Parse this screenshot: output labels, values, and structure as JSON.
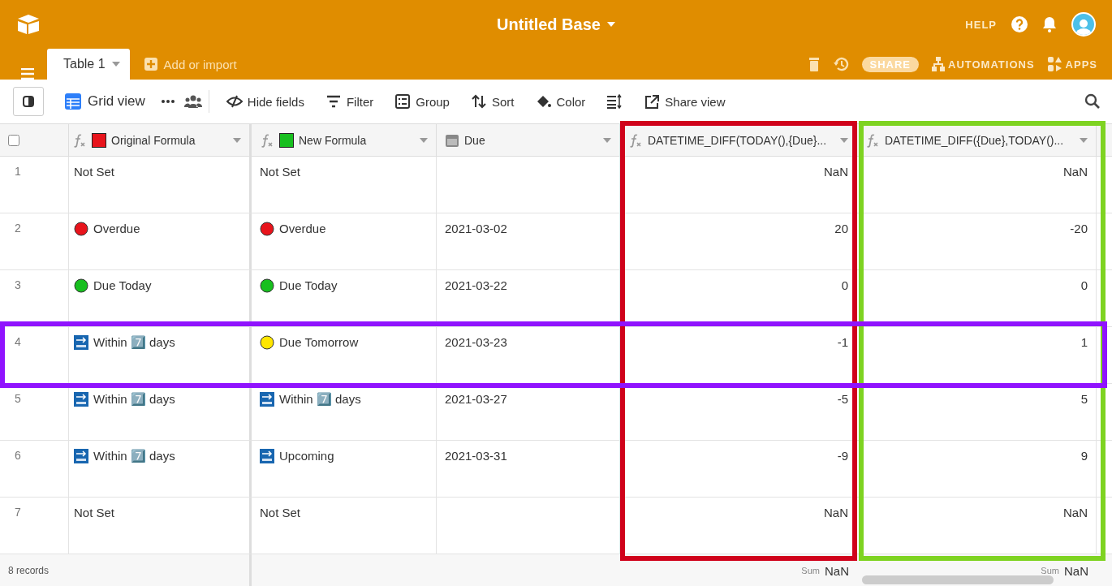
{
  "app": {
    "title": "Untitled Base",
    "help": "HELP",
    "tabs": [
      {
        "label": "Table 1",
        "selected": true
      }
    ],
    "add": "Add or import",
    "share": "SHARE",
    "automations": "AUTOMATIONS",
    "apps": "APPS"
  },
  "toolbar": {
    "view": "Grid view",
    "buttons": [
      {
        "kind": "hide",
        "label": "Hide fields"
      },
      {
        "kind": "filter",
        "label": "Filter"
      },
      {
        "kind": "group",
        "label": "Group"
      },
      {
        "kind": "sort",
        "label": "Sort"
      },
      {
        "kind": "color",
        "label": "Color"
      },
      {
        "kind": "height"
      },
      {
        "kind": "share",
        "label": "Share view"
      }
    ]
  },
  "table": {
    "select_all": {
      "checked": false
    },
    "columns": [
      {
        "kind": "formula",
        "color": "#e8141c",
        "label": "Original Formula"
      },
      {
        "kind": "formula",
        "color": "#18bf1f",
        "label": "New Formula"
      },
      {
        "kind": "date",
        "label": "Due"
      },
      {
        "kind": "formula",
        "label": "DATETIME_DIFF(TODAY(),{Due}...",
        "frame": {
          "color": "#d0021b"
        }
      },
      {
        "kind": "formula",
        "label": "DATETIME_DIFF({Due},TODAY()...",
        "frame": {
          "color": "#7ed321"
        }
      }
    ],
    "rows": [
      {
        "number": "1",
        "original": {
          "kind": "none",
          "text": "Not Set"
        },
        "new": {
          "kind": "none",
          "text": "Not Set"
        },
        "diff_a": "NaN",
        "diff_b": "NaN"
      },
      {
        "number": "2",
        "original": {
          "kind": "red",
          "text": "Overdue"
        },
        "new": {
          "kind": "red",
          "text": "Overdue"
        },
        "due": "2021-03-02",
        "diff_a": "20",
        "diff_b": "-20"
      },
      {
        "number": "3",
        "original": {
          "kind": "green",
          "text": "Due Today"
        },
        "new": {
          "kind": "green",
          "text": "Due Today"
        },
        "due": "2021-03-22",
        "diff_a": "0",
        "diff_b": "0"
      },
      {
        "number": "4",
        "frame": {
          "color": "#9013fe"
        },
        "original": {
          "kind": "soon",
          "text": "Within 7️⃣ days"
        },
        "new": {
          "kind": "yellow",
          "text": "Due Tomorrow"
        },
        "due": "2021-03-23",
        "diff_a": "-1",
        "diff_b": "1"
      },
      {
        "number": "5",
        "original": {
          "kind": "soon",
          "text": "Within 7️⃣ days"
        },
        "new": {
          "kind": "soon",
          "text": "Within 7️⃣ days"
        },
        "due": "2021-03-27",
        "diff_a": "-5",
        "diff_b": "5"
      },
      {
        "number": "6",
        "original": {
          "kind": "soon",
          "text": "Within 7️⃣ days"
        },
        "new": {
          "kind": "soon",
          "text": "Upcoming"
        },
        "due": "2021-03-31",
        "diff_a": "-9",
        "diff_b": "9"
      },
      {
        "number": "7",
        "original": {
          "kind": "none",
          "text": "Not Set"
        },
        "new": {
          "kind": "none",
          "text": "Not Set"
        },
        "diff_a": "NaN",
        "diff_b": "NaN"
      }
    ],
    "footer": {
      "records": "8 records",
      "sums": [
        {
          "label": "Sum",
          "value": "NaN"
        },
        {
          "label": "Sum",
          "value": "NaN"
        }
      ]
    }
  }
}
